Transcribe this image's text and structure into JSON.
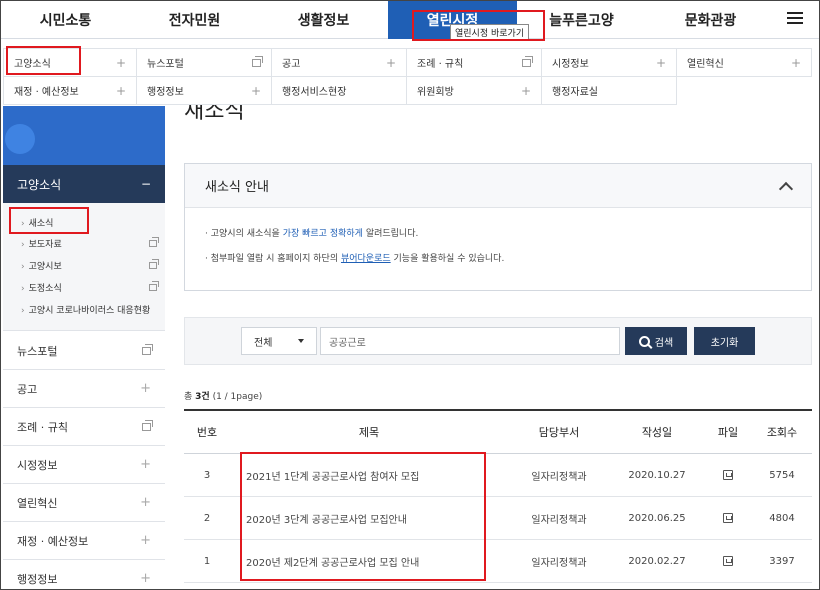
{
  "topnav": {
    "items": [
      "시민소통",
      "전자민원",
      "생활정보",
      "열린시정",
      "늘푸른고양",
      "문화관광"
    ],
    "active_index": 3,
    "tooltip": "열린시정 바로가기",
    "menu_icon": "hamburger-icon"
  },
  "mega": {
    "row1": [
      "고양소식",
      "뉴스포털",
      "공고",
      "조례 · 규칙",
      "시정정보",
      "열린혁신"
    ],
    "row2": [
      "재정 · 예산정보",
      "행정정보",
      "행정서비스현장",
      "위원회방",
      "행정자료실"
    ]
  },
  "sidebar": {
    "head": "고양소식",
    "head_icon": "−",
    "sub": [
      "새소식",
      "보도자료",
      "고양시보",
      "도정소식",
      "고양시 코로나바이러스 대응현황"
    ],
    "items": [
      "뉴스포털",
      "공고",
      "조례 · 규칙",
      "시정정보",
      "열린혁신",
      "재정 · 예산정보",
      "행정정보"
    ]
  },
  "page": {
    "title": "새소식"
  },
  "info": {
    "title": "새소식 안내",
    "line1_pre": "고양시의 새소식을 ",
    "line1_em": "가장 빠르고 정확하게",
    "line1_post": " 알려드립니다.",
    "line2_pre": "첨부파일 열람 시 홈페이지 하단의 ",
    "line2_link": "뷰어다운로드",
    "line2_post": " 기능을 활용하실 수 있습니다."
  },
  "search": {
    "select_value": "전체",
    "input_value": "공공근로",
    "search_label": "검색",
    "reset_label": "초기화"
  },
  "count": {
    "pre": "총 ",
    "num": "3건",
    "post": " (1 / 1page)"
  },
  "table": {
    "headers": [
      "번호",
      "제목",
      "담당부서",
      "작성일",
      "파일",
      "조회수"
    ],
    "rows": [
      {
        "no": "3",
        "title": "2021년 1단계 공공근로사업 참여자 모집",
        "dept": "일자리정책과",
        "date": "2020.10.27",
        "views": "5754"
      },
      {
        "no": "2",
        "title": "2020년 3단계 공공근로사업 모집안내",
        "dept": "일자리정책과",
        "date": "2020.06.25",
        "views": "4804"
      },
      {
        "no": "1",
        "title": "2020년 제2단계 공공근로사업 모집 안내",
        "dept": "일자리정책과",
        "date": "2020.02.27",
        "views": "3397"
      }
    ]
  },
  "colors": {
    "accent": "#1f5fb5",
    "dark": "#253a5a",
    "highlight": "#e0191f"
  }
}
